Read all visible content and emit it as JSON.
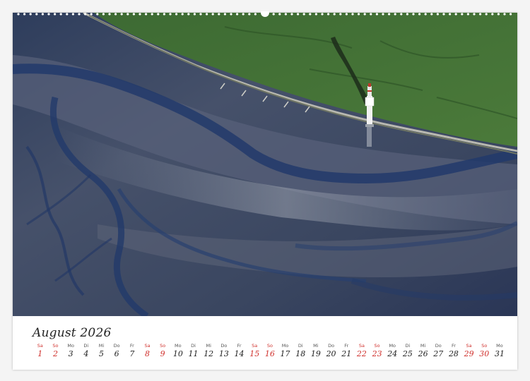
{
  "calendar": {
    "month_label": "August 2026",
    "days": [
      {
        "abbr": "Sa",
        "num": "1",
        "weekend": true
      },
      {
        "abbr": "So",
        "num": "2",
        "weekend": true
      },
      {
        "abbr": "Mo",
        "num": "3",
        "weekend": false
      },
      {
        "abbr": "Di",
        "num": "4",
        "weekend": false
      },
      {
        "abbr": "Mi",
        "num": "5",
        "weekend": false
      },
      {
        "abbr": "Do",
        "num": "6",
        "weekend": false
      },
      {
        "abbr": "Fr",
        "num": "7",
        "weekend": false
      },
      {
        "abbr": "Sa",
        "num": "8",
        "weekend": true
      },
      {
        "abbr": "So",
        "num": "9",
        "weekend": true
      },
      {
        "abbr": "Mo",
        "num": "10",
        "weekend": false
      },
      {
        "abbr": "Di",
        "num": "11",
        "weekend": false
      },
      {
        "abbr": "Mi",
        "num": "12",
        "weekend": false
      },
      {
        "abbr": "Do",
        "num": "13",
        "weekend": false
      },
      {
        "abbr": "Fr",
        "num": "14",
        "weekend": false
      },
      {
        "abbr": "Sa",
        "num": "15",
        "weekend": true
      },
      {
        "abbr": "So",
        "num": "16",
        "weekend": true
      },
      {
        "abbr": "Mo",
        "num": "17",
        "weekend": false
      },
      {
        "abbr": "Di",
        "num": "18",
        "weekend": false
      },
      {
        "abbr": "Mi",
        "num": "19",
        "weekend": false
      },
      {
        "abbr": "Do",
        "num": "20",
        "weekend": false
      },
      {
        "abbr": "Fr",
        "num": "21",
        "weekend": false
      },
      {
        "abbr": "Sa",
        "num": "22",
        "weekend": true
      },
      {
        "abbr": "So",
        "num": "23",
        "weekend": true
      },
      {
        "abbr": "Mo",
        "num": "24",
        "weekend": false
      },
      {
        "abbr": "Di",
        "num": "25",
        "weekend": false
      },
      {
        "abbr": "Mi",
        "num": "26",
        "weekend": false
      },
      {
        "abbr": "Do",
        "num": "27",
        "weekend": false
      },
      {
        "abbr": "Fr",
        "num": "28",
        "weekend": false
      },
      {
        "abbr": "Sa",
        "num": "29",
        "weekend": true
      },
      {
        "abbr": "So",
        "num": "30",
        "weekend": true
      },
      {
        "abbr": "Mo",
        "num": "31",
        "weekend": false
      }
    ]
  },
  "colors": {
    "weekend": "#d0312d",
    "weekday": "#222222",
    "mudflat": "#3b4a63",
    "marsh": "#3f6b32"
  }
}
